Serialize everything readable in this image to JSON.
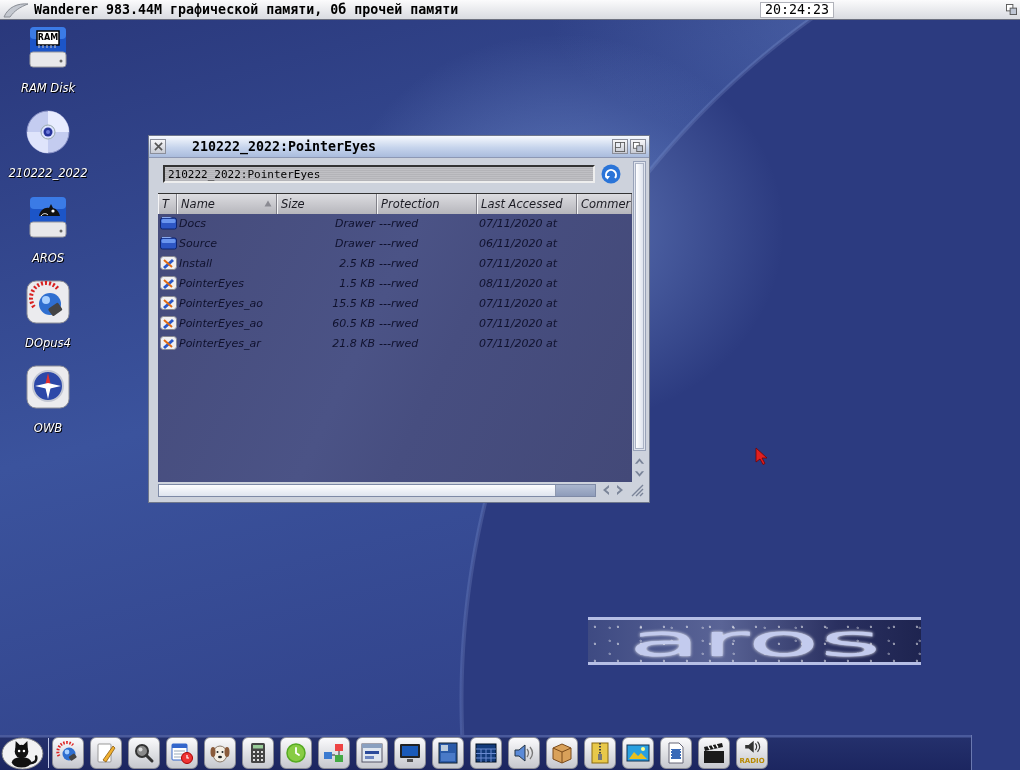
{
  "top_bar": {
    "title": "Wanderer 983.44M графической памяти, 0б прочей памяти",
    "clock": "20:24:23"
  },
  "desktop_icons": [
    {
      "label": "RAM Disk",
      "kind": "ram",
      "chip_label": "RAM"
    },
    {
      "label": "210222_2022",
      "kind": "cd"
    },
    {
      "label": "AROS",
      "kind": "disk"
    },
    {
      "label": "DOpus4",
      "kind": "gauge"
    },
    {
      "label": "OWB",
      "kind": "compass"
    }
  ],
  "window": {
    "title": "210222_2022:PointerEyes",
    "path": "210222_2022:PointerEyes",
    "columns": [
      {
        "label": "T",
        "sorted": false
      },
      {
        "label": "Name",
        "sorted": true
      },
      {
        "label": "Size",
        "sorted": false
      },
      {
        "label": "Protection",
        "sorted": false
      },
      {
        "label": "Last Accessed",
        "sorted": false
      },
      {
        "label": "Commer",
        "sorted": false
      }
    ],
    "rows": [
      {
        "kind": "drawer",
        "name": "Docs",
        "size": "Drawer",
        "protection": "---rwed",
        "last_accessed": "07/11/2020 at"
      },
      {
        "kind": "drawer",
        "name": "Source",
        "size": "Drawer",
        "protection": "---rwed",
        "last_accessed": "06/11/2020 at"
      },
      {
        "kind": "tool",
        "name": "Install",
        "size": "2.5 KB",
        "protection": "---rwed",
        "last_accessed": "07/11/2020 at"
      },
      {
        "kind": "tool",
        "name": "PointerEyes",
        "size": "1.5 KB",
        "protection": "---rwed",
        "last_accessed": "08/11/2020 at"
      },
      {
        "kind": "tool",
        "name": "PointerEyes_ao",
        "size": "15.5 KB",
        "protection": "---rwed",
        "last_accessed": "07/11/2020 at"
      },
      {
        "kind": "tool",
        "name": "PointerEyes_ao",
        "size": "60.5 KB",
        "protection": "---rwed",
        "last_accessed": "07/11/2020 at"
      },
      {
        "kind": "tool",
        "name": "PointerEyes_ar",
        "size": "21.8 KB",
        "protection": "---rwed",
        "last_accessed": "07/11/2020 at"
      }
    ]
  },
  "logo": {
    "text": "aros"
  },
  "dock": [
    {
      "kind": "start"
    },
    {
      "kind": "gauge"
    },
    {
      "kind": "notepad"
    },
    {
      "kind": "magnifier"
    },
    {
      "kind": "calendar"
    },
    {
      "kind": "dog"
    },
    {
      "kind": "calculator"
    },
    {
      "kind": "clock"
    },
    {
      "kind": "network"
    },
    {
      "kind": "window"
    },
    {
      "kind": "monitor"
    },
    {
      "kind": "panel"
    },
    {
      "kind": "grid"
    },
    {
      "kind": "speaker"
    },
    {
      "kind": "package"
    },
    {
      "kind": "archive"
    },
    {
      "kind": "picture"
    },
    {
      "kind": "filmdoc"
    },
    {
      "kind": "clapper"
    },
    {
      "kind": "radio",
      "label": "RADIO"
    }
  ]
}
